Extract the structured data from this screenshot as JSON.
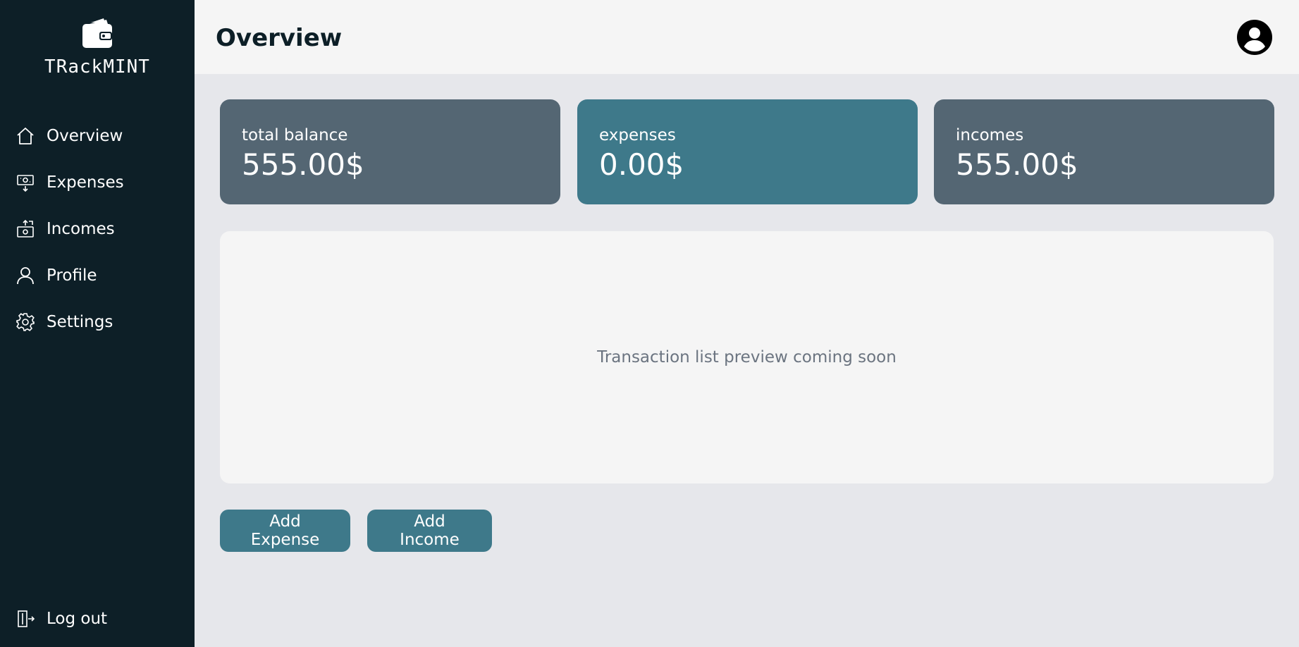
{
  "app": {
    "name": "TRackMINT",
    "logo_icon": "wallet-icon"
  },
  "sidebar": {
    "items": [
      {
        "label": "Overview",
        "icon": "home-icon"
      },
      {
        "label": "Expenses",
        "icon": "expense-icon"
      },
      {
        "label": "Incomes",
        "icon": "income-icon"
      },
      {
        "label": "Profile",
        "icon": "user-icon"
      },
      {
        "label": "Settings",
        "icon": "gear-icon"
      }
    ],
    "logout": {
      "label": "Log out",
      "icon": "logout-icon"
    }
  },
  "header": {
    "title": "Overview",
    "avatar_icon": "account-circle-icon"
  },
  "summary": {
    "balance": {
      "label": "total balance",
      "value": "555.00$"
    },
    "expenses": {
      "label": "expenses",
      "value": "0.00$"
    },
    "incomes": {
      "label": "incomes",
      "value": "555.00$"
    }
  },
  "preview": {
    "text": "Transaction list preview coming soon"
  },
  "actions": {
    "add_expense": "Add Expense",
    "add_income": "Add Income"
  },
  "colors": {
    "sidebar_bg": "#0d1f27",
    "card_slate": "#546673",
    "accent_teal": "#3e798a",
    "page_bg": "#e6e7eb"
  }
}
